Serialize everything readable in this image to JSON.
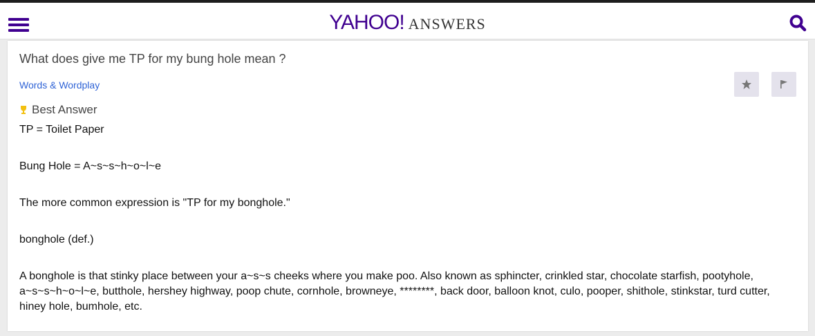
{
  "header": {
    "logo_yahoo": "YAHOO!",
    "logo_answers": "ANSWERS",
    "accent_color": "#400090"
  },
  "question": {
    "title": "What does give me TP for my bung hole mean ?",
    "category": "Words & Wordplay"
  },
  "actions": {
    "star_icon": "star-icon",
    "flag_icon": "flag-icon"
  },
  "best_answer": {
    "label": "Best Answer",
    "paragraphs": [
      "TP = Toilet Paper",
      "Bung Hole = A~s~s~h~o~l~e",
      "The more common expression is \"TP for my bonghole.\"",
      "bonghole (def.)",
      "A bonghole is that stinky place between your a~s~s cheeks where you make poo. Also known as sphincter, crinkled star, chocolate starfish, pootyhole, a~s~s~h~o~l~e, butthole, hershey highway, poop chute, cornhole, browneye, ********, back door, balloon knot, culo, pooper, shithole, stinkstar, turd cutter, hiney hole, bumhole, etc."
    ]
  }
}
